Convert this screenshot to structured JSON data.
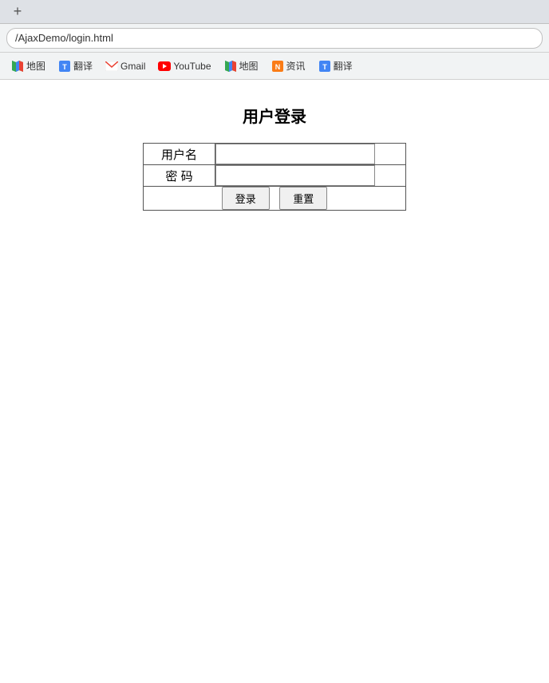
{
  "browser": {
    "tab_plus_label": "+",
    "address_bar_value": "/AjaxDemo/login.html",
    "bookmarks": [
      {
        "id": "maps1",
        "label": "地图",
        "icon_type": "maps"
      },
      {
        "id": "translate1",
        "label": "翻译",
        "icon_type": "translate"
      },
      {
        "id": "gmail",
        "label": "Gmail",
        "icon_type": "gmail"
      },
      {
        "id": "youtube",
        "label": "YouTube",
        "icon_type": "youtube"
      },
      {
        "id": "maps2",
        "label": "地图",
        "icon_type": "maps"
      },
      {
        "id": "news",
        "label": "资讯",
        "icon_type": "news"
      },
      {
        "id": "translate2",
        "label": "翻译",
        "icon_type": "translate"
      }
    ]
  },
  "page": {
    "title": "用户登录",
    "username_label": "用户名",
    "password_label": "密 码",
    "login_button": "登录",
    "reset_button": "重置"
  }
}
